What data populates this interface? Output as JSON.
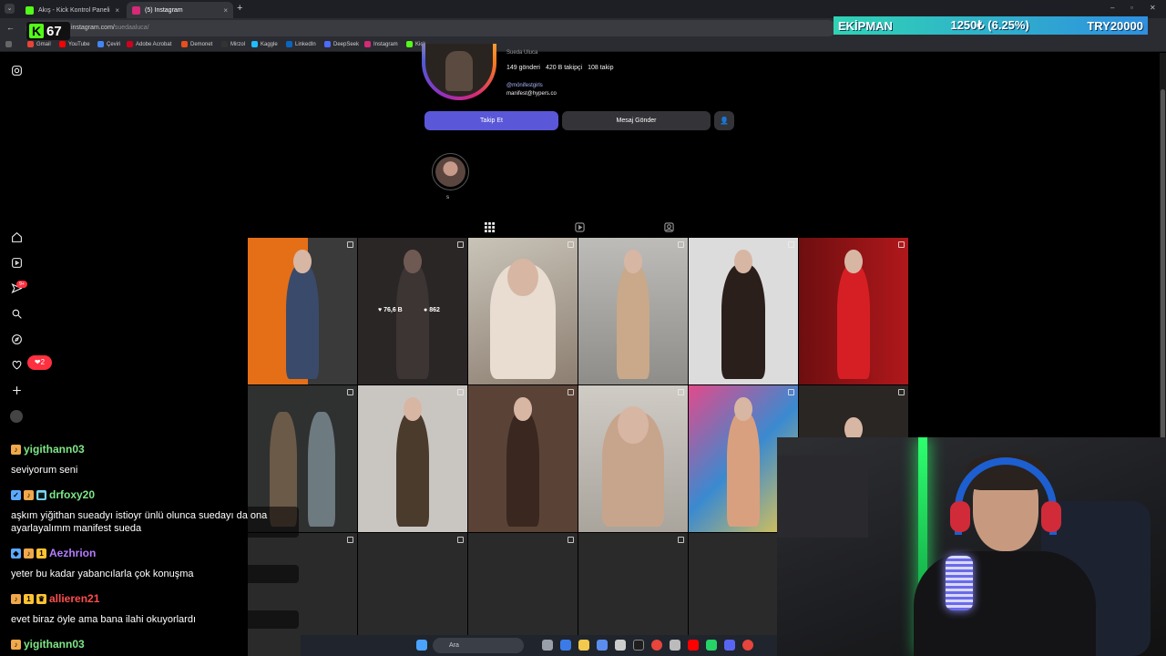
{
  "browser": {
    "tabs": [
      {
        "title": "Akış - Kick Kontrol Paneli",
        "active": false,
        "favicon_color": "#53fc18"
      },
      {
        "title": "(5) Instagram",
        "active": true,
        "favicon_color": "#d62976"
      }
    ],
    "address": {
      "domain": "instagram.com/",
      "path": "suedaaluca/"
    },
    "bookmarks": [
      {
        "label": "Gmail",
        "color": "#ea4335"
      },
      {
        "label": "YouTube",
        "color": "#ff0000"
      },
      {
        "label": "Çeviri",
        "color": "#4285f4"
      },
      {
        "label": "Adobe Acrobat",
        "color": "#d0021b"
      },
      {
        "label": "Demonet",
        "color": "#e94e1b"
      },
      {
        "label": "Mirzol",
        "color": "#333"
      },
      {
        "label": "Kaggle",
        "color": "#20beff"
      },
      {
        "label": "LinkedIn",
        "color": "#0a66c2"
      },
      {
        "label": "DeepSeek",
        "color": "#4d6bfe"
      },
      {
        "label": "Instagram",
        "color": "#d62976"
      },
      {
        "label": "Kick",
        "color": "#53fc18"
      }
    ]
  },
  "overlay": {
    "kick_logo": "K",
    "kick_count": "67",
    "ticker": {
      "label": "EKİPMAN",
      "progress": "1250₺ (6.25%)",
      "goal": "TRY20000"
    }
  },
  "profile": {
    "name": "Sueda Uluca",
    "stats": [
      "149 gönderi",
      "420 B takipçi",
      "108 takip"
    ],
    "tag": "@mönifestgirls",
    "email": "manifest@hypers.co",
    "follow_label": "Takip Et",
    "message_label": "Mesaj Gönder",
    "highlight_label": "s",
    "hovered_post": {
      "likes": "76,6 B",
      "comments": "862"
    }
  },
  "chat": [
    {
      "user": "yigithann03",
      "color": "#7ee787",
      "badges": [
        "#f0a84a"
      ],
      "text": "seviyorum seni"
    },
    {
      "user": "drfoxy20",
      "color": "#7ee787",
      "badges": [
        "#5aa9ff",
        "#f0a84a",
        "#7ad7f0"
      ],
      "text": "aşkım yiğithan sueadyı istioyr ünlü olunca suedayı da ona ayarlayalımm manifest sueda"
    },
    {
      "user": "Aezhrion",
      "color": "#b57cff",
      "badges": [
        "#5aa9ff",
        "#f0a84a",
        "#ffc233"
      ],
      "text": "yeter bu kadar yabancılarla çok konuşma"
    },
    {
      "user": "allieren21",
      "color": "#ff4d4d",
      "badges": [
        "#f0a84a",
        "#ffc233",
        "#ffc233"
      ],
      "text": "evet biraz öyle ama bana ilahi okuyorlardı"
    },
    {
      "user": "yigithann03",
      "color": "#7ee787",
      "badges": [
        "#f0a84a"
      ],
      "text": ""
    }
  ],
  "taskbar": {
    "search_placeholder": "Ara"
  }
}
